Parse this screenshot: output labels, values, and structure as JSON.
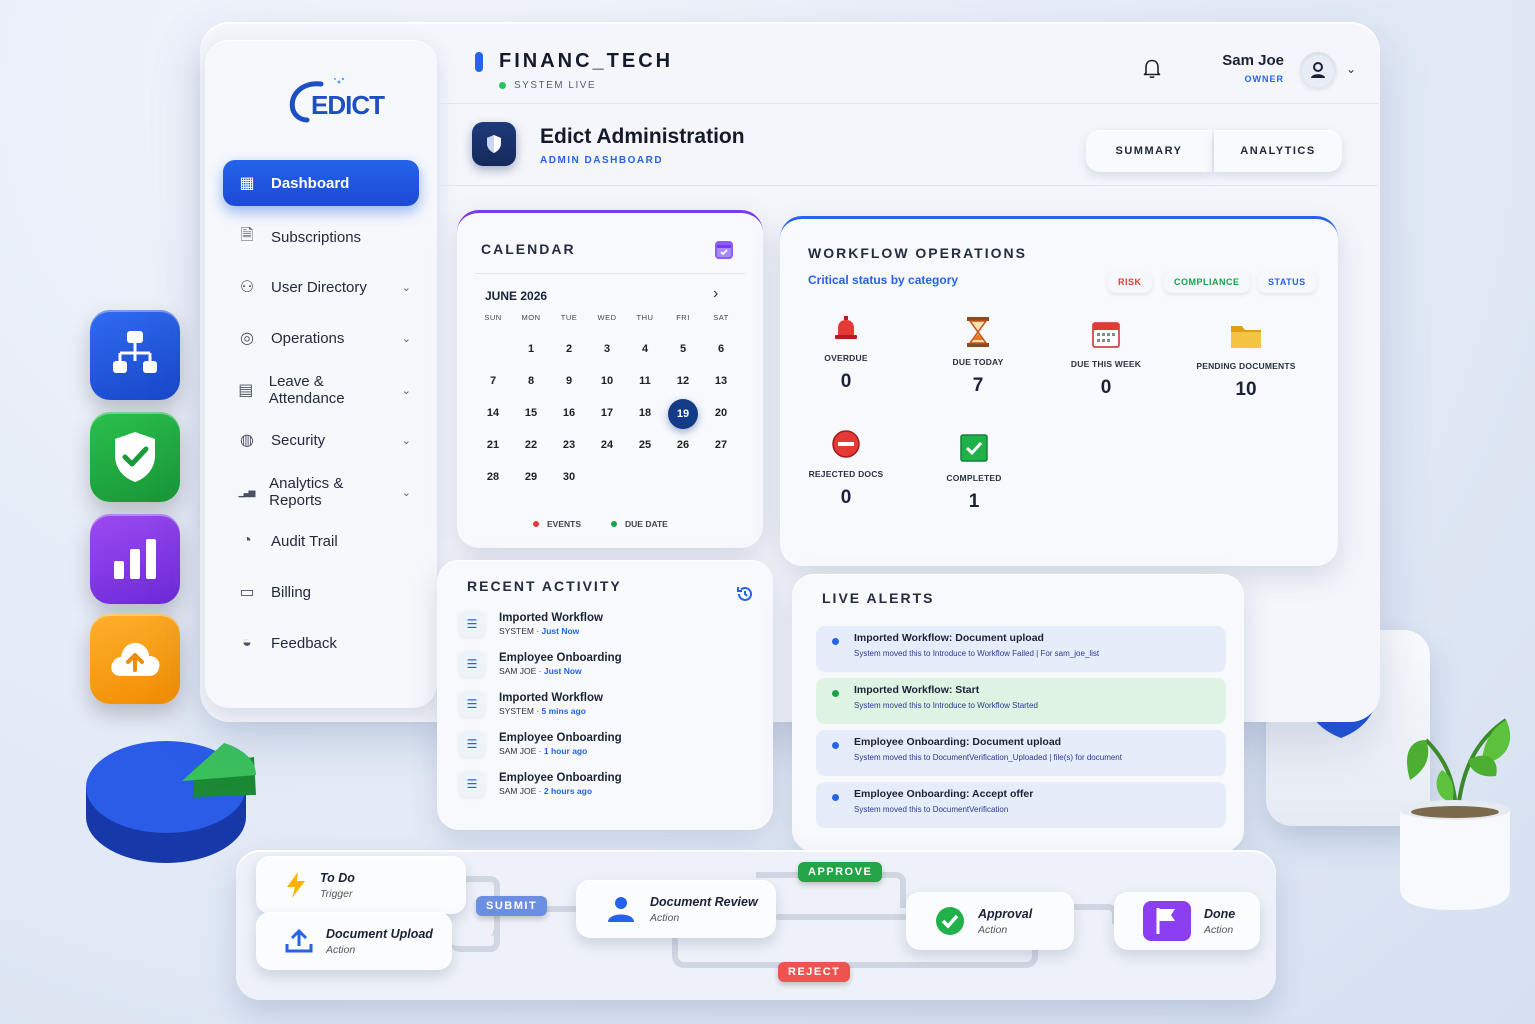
{
  "sidebar": {
    "logo": "EDICT",
    "items": [
      {
        "label": "Dashboard",
        "icon": "dashboard-icon",
        "active": true
      },
      {
        "label": "Subscriptions",
        "icon": "document-icon"
      },
      {
        "label": "User Directory",
        "icon": "users-icon",
        "expandable": true
      },
      {
        "label": "Operations",
        "icon": "globe-icon",
        "expandable": true
      },
      {
        "label": "Leave & Attendance",
        "icon": "calendar-icon",
        "expandable": true
      },
      {
        "label": "Security",
        "icon": "user-lock-icon",
        "expandable": true
      },
      {
        "label": "Analytics & Reports",
        "icon": "bar-chart-icon",
        "expandable": true
      },
      {
        "label": "Audit Trail",
        "icon": "audit-icon"
      },
      {
        "label": "Billing",
        "icon": "billing-icon"
      },
      {
        "label": "Feedback",
        "icon": "feedback-icon"
      }
    ]
  },
  "header": {
    "brand": "FINANC_TECH",
    "status": "SYSTEM LIVE",
    "user_name": "Sam Joe",
    "user_role": "OWNER",
    "page_title": "Edict Administration",
    "page_subtitle": "ADMIN DASHBOARD",
    "tabs": [
      "SUMMARY",
      "ANALYTICS"
    ]
  },
  "calendar": {
    "title": "CALENDAR",
    "month": "JUNE 2026",
    "weekdays": [
      "SUN",
      "MON",
      "TUE",
      "WED",
      "THU",
      "FRI",
      "SAT"
    ],
    "weeks": [
      [
        "",
        "1",
        "2",
        "3",
        "4",
        "5",
        "6"
      ],
      [
        "7",
        "8",
        "9",
        "10",
        "11",
        "12",
        "13"
      ],
      [
        "14",
        "15",
        "16",
        "17",
        "18",
        "19",
        "20"
      ],
      [
        "21",
        "22",
        "23",
        "24",
        "25",
        "26",
        "27"
      ],
      [
        "28",
        "29",
        "30",
        "",
        "",
        "",
        ""
      ]
    ],
    "today": "19",
    "legend": [
      {
        "label": "EVENTS",
        "color": "#e53935"
      },
      {
        "label": "DUE DATE",
        "color": "#16a34a"
      }
    ]
  },
  "workflow": {
    "title": "WORKFLOW OPERATIONS",
    "subtitle": "Critical status by category",
    "chips": [
      {
        "label": "RISK",
        "color": "#e53935"
      },
      {
        "label": "COMPLIANCE",
        "color": "#16a34a"
      },
      {
        "label": "STATUS",
        "color": "#2563eb"
      }
    ],
    "stats": [
      {
        "label": "OVERDUE",
        "value": "0",
        "icon": "alarm-icon"
      },
      {
        "label": "DUE TODAY",
        "value": "7",
        "icon": "hourglass-icon"
      },
      {
        "label": "DUE THIS WEEK",
        "value": "0",
        "icon": "calendar-icon"
      },
      {
        "label": "PENDING DOCUMENTS",
        "value": "10",
        "icon": "folder-icon"
      },
      {
        "label": "REJECTED DOCS",
        "value": "0",
        "icon": "no-entry-icon"
      },
      {
        "label": "COMPLETED",
        "value": "1",
        "icon": "check-box-icon"
      }
    ]
  },
  "recent": {
    "title": "RECENT ACTIVITY",
    "items": [
      {
        "title": "Imported Workflow",
        "by": "SYSTEM",
        "when": "Just Now"
      },
      {
        "title": "Employee Onboarding",
        "by": "SAM JOE",
        "when": "Just Now"
      },
      {
        "title": "Imported Workflow",
        "by": "SYSTEM",
        "when": "5 mins ago"
      },
      {
        "title": "Employee Onboarding",
        "by": "SAM JOE",
        "when": "1 hour ago"
      },
      {
        "title": "Employee Onboarding",
        "by": "SAM JOE",
        "when": "2 hours ago"
      }
    ]
  },
  "alerts": {
    "title": "LIVE ALERTS",
    "items": [
      {
        "title": "Imported Workflow: Document upload",
        "detail": "System moved this to Introduce to Workflow Failed | For sam_joe_list",
        "color": "#2563eb",
        "bg": "#e6edfa"
      },
      {
        "title": "Imported Workflow: Start",
        "detail": "System moved this to Introduce to Workflow Started",
        "color": "#16a34a",
        "bg": "#dff3e3"
      },
      {
        "title": "Employee Onboarding: Document upload",
        "detail": "System moved this to DocumentVerification_Uploaded | file(s) for document",
        "color": "#2563eb",
        "bg": "#e6edfa"
      },
      {
        "title": "Employee Onboarding: Accept offer",
        "detail": "System moved this to DocumentVerification",
        "color": "#2563eb",
        "bg": "#e6edfa"
      }
    ]
  },
  "flow": {
    "nodes": [
      {
        "title": "To Do",
        "sub": "Trigger",
        "icon": "lightning-icon"
      },
      {
        "title": "Document Upload",
        "sub": "Action",
        "icon": "upload-icon"
      },
      {
        "title": "Document Review",
        "sub": "Action",
        "icon": "reviewer-icon"
      },
      {
        "title": "Approval",
        "sub": "Action",
        "icon": "check-circle-icon"
      },
      {
        "title": "Done",
        "sub": "Action",
        "icon": "flag-icon"
      }
    ],
    "transitions": [
      {
        "label": "SUBMIT",
        "color": "#6b8ee0"
      },
      {
        "label": "APPROVE",
        "color": "#22a447"
      },
      {
        "label": "REJECT",
        "color": "#ef5350"
      }
    ]
  },
  "app_icons": [
    "org-chart-icon",
    "shield-check-icon",
    "bar-chart-icon",
    "cloud-upload-icon"
  ],
  "colors": {
    "accent": "#2563eb",
    "purple": "#7c3aed",
    "green": "#16a34a",
    "red": "#e53935",
    "navy": "#143b85"
  }
}
